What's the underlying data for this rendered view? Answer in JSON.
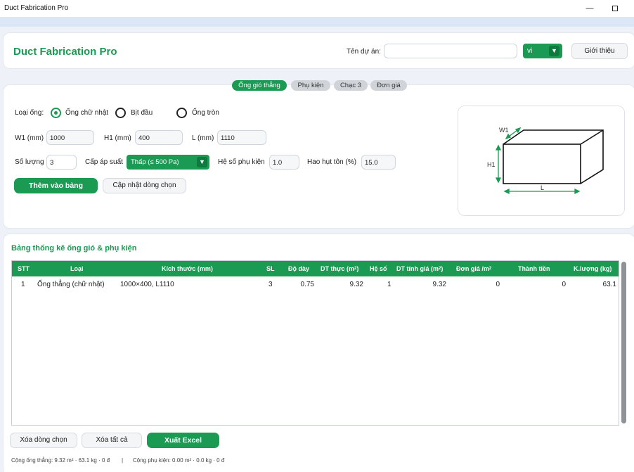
{
  "window": {
    "title": "Duct Fabrication Pro",
    "minimize": "—"
  },
  "header": {
    "app_title": "Duct Fabrication Pro",
    "project_label": "Tên dự án:",
    "project_value": "",
    "lang_value": "vi",
    "about_label": "Giới thiệu"
  },
  "tabs": [
    {
      "label": "Ống gió thẳng",
      "active": true
    },
    {
      "label": "Phụ kiện",
      "active": false
    },
    {
      "label": "Chạc 3",
      "active": false
    },
    {
      "label": "Đơn giá",
      "active": false
    }
  ],
  "form": {
    "type_label": "Loại ống:",
    "type_options": [
      {
        "label": "Ống chữ nhật",
        "selected": true
      },
      {
        "label": "Bịt đầu",
        "selected": false
      },
      {
        "label": "Ống tròn",
        "selected": false
      }
    ],
    "w1_label": "W1 (mm)",
    "w1_value": "1000",
    "h1_label": "H1 (mm)",
    "h1_value": "400",
    "l_label": "L (mm)",
    "l_value": "1110",
    "qty_label": "Số lượng",
    "qty_value": "3",
    "pressure_label": "Cấp áp suất",
    "pressure_value": "Thấp (≤ 500 Pa)",
    "fitting_factor_label": "Hệ số phụ kiện",
    "fitting_factor_value": "1.0",
    "waste_label": "Hao hụt tôn (%)",
    "waste_value": "15.0",
    "add_button": "Thêm vào bảng",
    "update_button": "Cập nhật dòng chọn"
  },
  "diagram": {
    "w_label": "W1",
    "h_label": "H1",
    "l_label": "L"
  },
  "table": {
    "section_title": "Bảng thống kê ống gió & phụ kiện",
    "headers": {
      "stt": "STT",
      "type": "Loại",
      "size": "Kích thước (mm)",
      "qty": "SL",
      "thickness": "Độ dày",
      "area_actual": "DT thực (m",
      "factor": "Hệ số",
      "area_price": "DT tính giá (m",
      "unit_price": "Đơn giá /m",
      "amount": "Thành tiền",
      "weight": "K.lượng (kg)",
      "sq": "2"
    },
    "rows": [
      {
        "stt": "1",
        "type": "Ống thẳng (chữ nhật)",
        "size": "1000×400, L1110",
        "qty": "3",
        "thickness": "0.75",
        "area_actual": "9.32",
        "factor": "1",
        "area_price": "9.32",
        "unit_price": "0",
        "amount": "0",
        "weight": "63.1"
      }
    ]
  },
  "actions": {
    "delete_row": "Xóa dòng chọn",
    "delete_all": "Xóa tất cả",
    "export": "Xuất Excel"
  },
  "footer": {
    "straight_summary": "Cộng ống thẳng: 9.32 m² · 63.1 kg · 0 đ",
    "separator": "|",
    "fitting_summary": "Cộng phụ kiện: 0.00 m² · 0.0 kg · 0 đ"
  },
  "colors": {
    "accent": "#1a9a52",
    "accent_dark": "#0f7a3e"
  }
}
